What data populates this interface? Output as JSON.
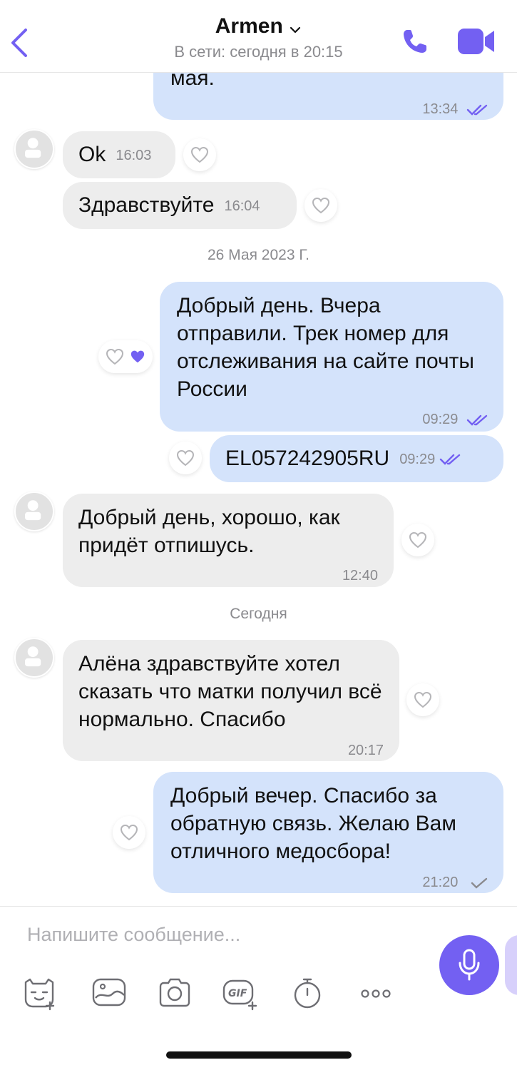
{
  "header": {
    "back_icon": "chevron-left-icon",
    "title": "Armen",
    "status": "В сети: сегодня в 20:15",
    "accent": "#7360f2"
  },
  "messages": [
    {
      "dir": "out",
      "text": "мая.",
      "time": "13:34",
      "status": "read"
    },
    {
      "dir": "in",
      "text": "Ok",
      "time": "16:03",
      "avatar": true
    },
    {
      "dir": "in",
      "text": "Здравствуйте",
      "time": "16:04"
    },
    {
      "dir": "out",
      "text": "Добрый день. Вчера отправили. Трек номер для отслеживания на сайте почты России",
      "time": "09:29",
      "status": "read",
      "liked": true
    },
    {
      "dir": "out",
      "text": "EL057242905RU",
      "time": "09:29",
      "status": "read"
    },
    {
      "dir": "in",
      "text": "Добрый день, хорошо, как придёт отпишусь.",
      "time": "12:40",
      "avatar": true
    },
    {
      "dir": "in",
      "text": "Алёна здравствуйте хотел сказать что матки получил всё нормально. Спасибо",
      "time": "20:17",
      "avatar": true
    },
    {
      "dir": "out",
      "text": "Добрый вечер. Спасибо за обратную связь. Желаю Вам отличного медосбора!",
      "time": "21:20",
      "status": "delivered"
    }
  ],
  "separators": {
    "date1": "26 Мая 2023 Г.",
    "date2": "Сегодня"
  },
  "composer": {
    "placeholder": "Напишите сообщение...",
    "tools": [
      "sticker-icon",
      "gallery-icon",
      "camera-icon",
      "gif-icon",
      "timer-icon",
      "more-icon"
    ],
    "mic_color": "#7360f2"
  },
  "colors": {
    "incoming_bubble": "#ededed",
    "outgoing_bubble": "#d4e3fb",
    "read_ticks": "#7360f2",
    "delivered_tick": "#8a8a8e"
  }
}
